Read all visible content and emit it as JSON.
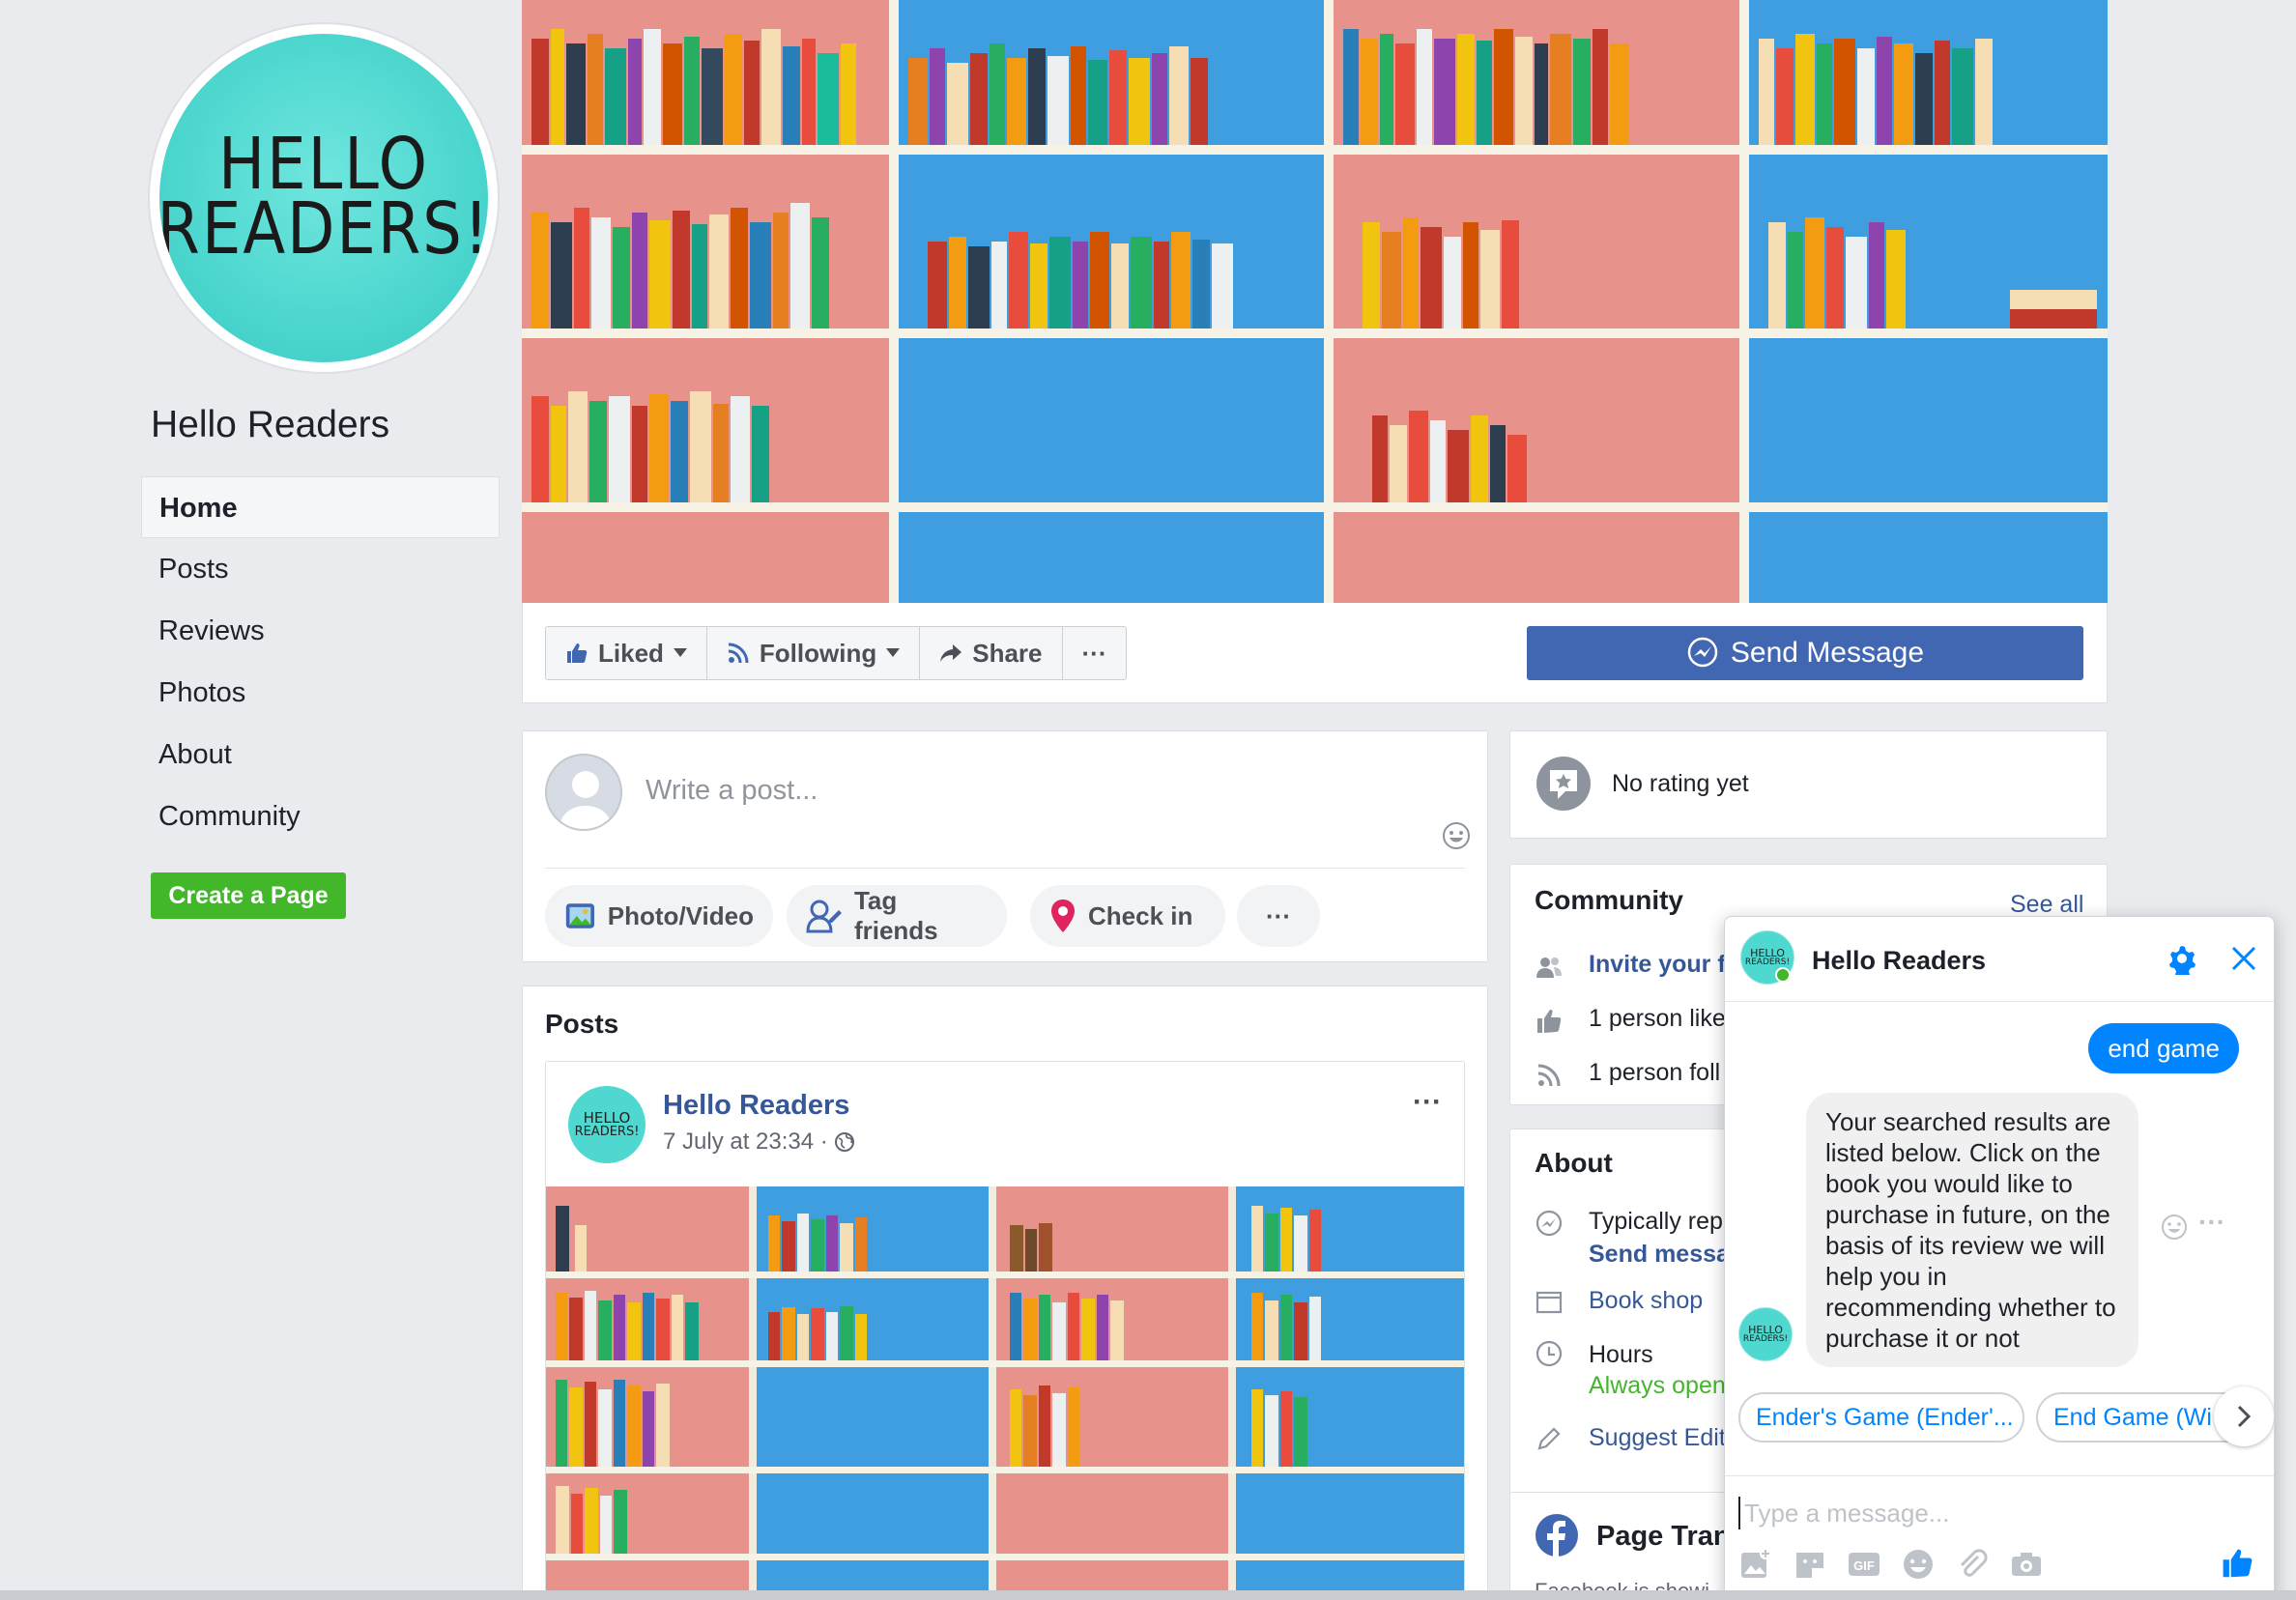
{
  "page": {
    "name": "Hello Readers",
    "logo_text_line1": "HELLO",
    "logo_text_line2": "READERS!"
  },
  "nav": {
    "items": [
      "Home",
      "Posts",
      "Reviews",
      "Photos",
      "About",
      "Community"
    ],
    "active": "Home",
    "create_page": "Create a Page"
  },
  "actions": {
    "liked": "Liked",
    "following": "Following",
    "share": "Share",
    "more": "···",
    "send_message": "Send Message"
  },
  "composer": {
    "placeholder": "Write a post...",
    "photo_video": "Photo/Video",
    "tag_friends": "Tag friends",
    "check_in": "Check in",
    "more": "···"
  },
  "posts": {
    "title": "Posts",
    "first": {
      "author": "Hello Readers",
      "time": "7 July at 23:34 ·",
      "more": "···"
    }
  },
  "right": {
    "rating": "No rating yet",
    "community": {
      "title": "Community",
      "see_all": "See all",
      "invite": "Invite your f",
      "likes": "1 person like",
      "follows": "1 person foll"
    },
    "about": {
      "title": "About",
      "typically": "Typically rep",
      "send_message": "Send messa",
      "category": "Book shop",
      "hours": "Hours",
      "always_open": "Always open",
      "suggest_edit": "Suggest Edit"
    },
    "transparency": {
      "title": "Page Tran",
      "subtitle": "Facebook is showi"
    }
  },
  "chat": {
    "title": "Hello Readers",
    "user_message": "end game",
    "bot_message": "Your searched results are listed below. Click on the book you would like to purchase in future, on the basis of its review we will help you in recommending whether to purchase it or not",
    "quick_replies": [
      "Ender's Game (Ender'...",
      "End Game (Wi"
    ],
    "placeholder": "Type a message...",
    "colors": {
      "accent": "#0084ff",
      "online": "#42b72a"
    }
  },
  "colors": {
    "fb_blue": "#4267b2",
    "link": "#365899",
    "green": "#42b72a",
    "background": "#e9ebee"
  }
}
